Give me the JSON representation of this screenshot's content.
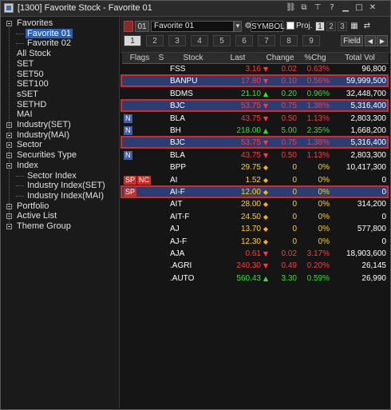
{
  "window": {
    "title": "[1300] Favorite Stock - Favorite 01"
  },
  "tree": {
    "items": [
      {
        "label": "Favorites",
        "level": 0,
        "expander": true
      },
      {
        "label": "Favorite 01",
        "level": 1,
        "selected": true
      },
      {
        "label": "Favorite 02",
        "level": 1
      },
      {
        "label": "All Stock",
        "level": 0
      },
      {
        "label": "SET",
        "level": 0
      },
      {
        "label": "SET50",
        "level": 0
      },
      {
        "label": "SET100",
        "level": 0
      },
      {
        "label": "sSET",
        "level": 0
      },
      {
        "label": "SETHD",
        "level": 0
      },
      {
        "label": "MAI",
        "level": 0
      },
      {
        "label": "Industry(SET)",
        "level": 0,
        "expander": true
      },
      {
        "label": "Industry(MAI)",
        "level": 0,
        "expander": true
      },
      {
        "label": "Sector",
        "level": 0,
        "expander": true
      },
      {
        "label": "Securities Type",
        "level": 0,
        "expander": true
      },
      {
        "label": "Index",
        "level": 0,
        "expander": true
      },
      {
        "label": "Sector Index",
        "level": 1
      },
      {
        "label": "Industry Index(SET)",
        "level": 1
      },
      {
        "label": "Industry Index(MAI)",
        "level": 1
      },
      {
        "label": "Portfolio",
        "level": 0,
        "expander": true
      },
      {
        "label": "Active List",
        "level": 0,
        "expander": true
      },
      {
        "label": "Theme Group",
        "level": 0,
        "expander": true
      }
    ]
  },
  "toolbar": {
    "favorite_num": "01",
    "favorite_combo": "Favorite 01",
    "symbol_label": "SYMBOL",
    "proj_label": "Proj.",
    "top_pages": [
      "1",
      "2",
      "3"
    ],
    "bottom_pages": [
      "1",
      "2",
      "3",
      "4",
      "5",
      "6",
      "7",
      "8",
      "9"
    ],
    "field_label": "Field"
  },
  "grid": {
    "headers": [
      "Flags",
      "S",
      "Stock",
      "Last",
      "Change",
      "%Chg",
      "Total Vol"
    ],
    "rows": [
      {
        "flags": [],
        "stock": "FSS",
        "last": "3.16",
        "dir": "down",
        "chg": "0.02",
        "pct": "0.63%",
        "vol": "96,800",
        "color": "red"
      },
      {
        "flags": [],
        "stock": "BANPU",
        "last": "17.80",
        "dir": "down",
        "chg": "0.10",
        "pct": "0.56%",
        "vol": "59,999,500",
        "color": "red",
        "selected": true,
        "framed": true
      },
      {
        "flags": [],
        "stock": "BDMS",
        "last": "21.10",
        "dir": "up",
        "chg": "0.20",
        "pct": "0.96%",
        "vol": "32,448,700",
        "color": "green"
      },
      {
        "flags": [],
        "stock": "BJC",
        "last": "53.75",
        "dir": "down",
        "chg": "0.75",
        "pct": "1.38%",
        "vol": "5,316,400",
        "color": "red",
        "selected": true,
        "framed": true
      },
      {
        "flags": [
          "N"
        ],
        "stock": "BLA",
        "last": "43.75",
        "dir": "down",
        "chg": "0.50",
        "pct": "1.13%",
        "vol": "2,803,300",
        "color": "red"
      },
      {
        "flags": [
          "N"
        ],
        "stock": "BH",
        "last": "218.00",
        "dir": "up",
        "chg": "5.00",
        "pct": "2.35%",
        "vol": "1,668,200",
        "color": "green"
      },
      {
        "flags": [],
        "stock": "BJC",
        "last": "53.75",
        "dir": "down",
        "chg": "0.75",
        "pct": "1.38%",
        "vol": "5,316,400",
        "color": "red",
        "selected": true,
        "framed": true
      },
      {
        "flags": [
          "N"
        ],
        "stock": "BLA",
        "last": "43.75",
        "dir": "down",
        "chg": "0.50",
        "pct": "1.13%",
        "vol": "2,803,300",
        "color": "red"
      },
      {
        "flags": [],
        "stock": "BPP",
        "last": "29.75",
        "dir": "eq",
        "chg": "0",
        "pct": "0%",
        "vol": "10,417,300",
        "color": "yellow"
      },
      {
        "flags": [
          "SP",
          "NC"
        ],
        "stock": "AI",
        "last": "1.52",
        "dir": "eq",
        "chg": "0",
        "pct": "0%",
        "vol": "0",
        "color": "yellow",
        "framed": true
      },
      {
        "flags": [
          "SP"
        ],
        "stock": "AI-F",
        "last": "12.00",
        "dir": "eq",
        "chg": "0",
        "pct": "0%",
        "vol": "0",
        "color": "yellow",
        "selected": true,
        "framed": true
      },
      {
        "flags": [],
        "stock": "AIT",
        "last": "28.00",
        "dir": "eq",
        "chg": "0",
        "pct": "0%",
        "vol": "314,200",
        "color": "yellow"
      },
      {
        "flags": [],
        "stock": "AIT-F",
        "last": "24.50",
        "dir": "eq",
        "chg": "0",
        "pct": "0%",
        "vol": "0",
        "color": "yellow"
      },
      {
        "flags": [],
        "stock": "AJ",
        "last": "13.70",
        "dir": "eq",
        "chg": "0",
        "pct": "0%",
        "vol": "577,800",
        "color": "yellow"
      },
      {
        "flags": [],
        "stock": "AJ-F",
        "last": "12.30",
        "dir": "eq",
        "chg": "0",
        "pct": "0%",
        "vol": "0",
        "color": "yellow"
      },
      {
        "flags": [],
        "stock": "AJA",
        "last": "0.61",
        "dir": "down",
        "chg": "0.02",
        "pct": "3.17%",
        "vol": "18,903,600",
        "color": "red"
      },
      {
        "flags": [],
        "stock": ".AGRI",
        "last": "240.30",
        "dir": "down",
        "chg": "0.49",
        "pct": "0.20%",
        "vol": "26,145",
        "color": "red"
      },
      {
        "flags": [],
        "stock": ".AUTO",
        "last": "560.43",
        "dir": "up",
        "chg": "3.30",
        "pct": "0.59%",
        "vol": "26,990",
        "color": "green"
      }
    ]
  },
  "colors": {
    "up": "#33e033",
    "down": "#ff3a3a",
    "unchanged": "#ffd21a",
    "selection": "#2b3e73",
    "frame": "#d42a2a",
    "tree_selection": "#2a5fb3"
  }
}
